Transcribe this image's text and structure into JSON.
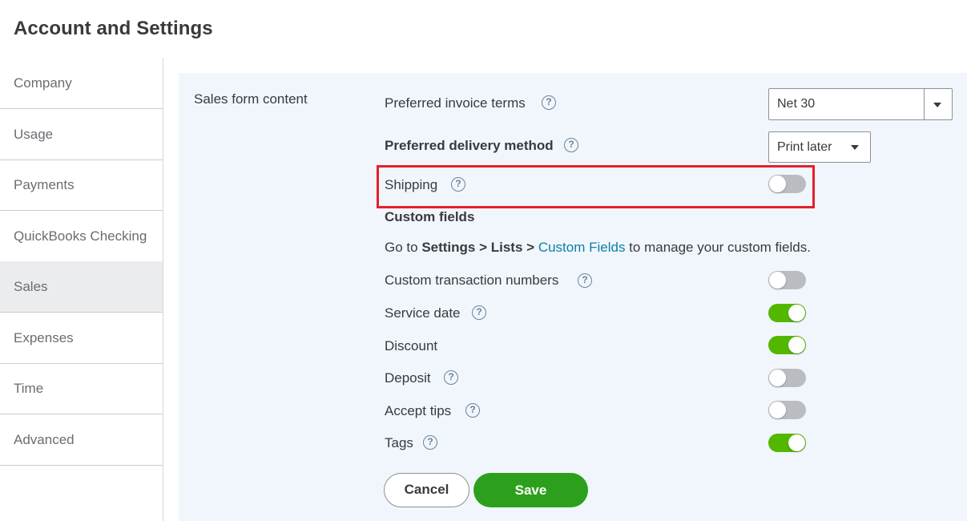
{
  "title": "Account and Settings",
  "sidebar": {
    "items": [
      {
        "label": "Company"
      },
      {
        "label": "Usage"
      },
      {
        "label": "Payments"
      },
      {
        "label": "QuickBooks Checking"
      },
      {
        "label": "Sales",
        "active": true
      },
      {
        "label": "Expenses"
      },
      {
        "label": "Time"
      },
      {
        "label": "Advanced"
      }
    ]
  },
  "section": {
    "label": "Sales form content",
    "preferred_terms": {
      "label": "Preferred invoice terms",
      "value": "Net 30"
    },
    "delivery_method": {
      "label": "Preferred delivery method",
      "value": "Print later"
    },
    "shipping": {
      "label": "Shipping",
      "enabled": false
    },
    "custom_fields": {
      "heading": "Custom fields",
      "text_prefix": "Go to ",
      "path_settings": "Settings",
      "path_sep1": " > ",
      "path_lists": "Lists",
      "path_sep2": " > ",
      "link": "Custom Fields",
      "text_suffix": " to manage your custom fields."
    },
    "toggles": [
      {
        "label": "Custom transaction numbers",
        "enabled": false,
        "help": true
      },
      {
        "label": "Service date",
        "enabled": true,
        "help": true
      },
      {
        "label": "Discount",
        "enabled": true,
        "help": false
      },
      {
        "label": "Deposit",
        "enabled": false,
        "help": true
      },
      {
        "label": "Accept tips",
        "enabled": false,
        "help": true
      },
      {
        "label": "Tags",
        "enabled": true,
        "help": true
      }
    ]
  },
  "buttons": {
    "cancel": "Cancel",
    "save": "Save"
  },
  "help_glyph": "?",
  "colors": {
    "toggle_on": "#53b700",
    "save": "#2ca01c",
    "link": "#0d7fa5",
    "highlight": "#e3202a"
  }
}
